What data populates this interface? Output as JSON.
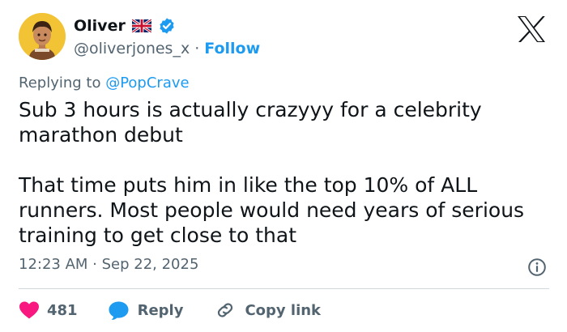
{
  "author": {
    "name": "Oliver",
    "handle": "@oliverjones_x",
    "separator": "·",
    "follow_label": "Follow"
  },
  "reply": {
    "prefix": "Replying to ",
    "mention": "@PopCrave"
  },
  "tweet": {
    "paragraph1": "Sub 3 hours is actually crazyyy for a celebrity marathon debut",
    "paragraph2": "That time puts him in like the top 10% of ALL runners. Most people would need years of serious training to get close to that"
  },
  "timestamp": "12:23 AM · Sep 22, 2025",
  "actions": {
    "like_count": "481",
    "reply_label": "Reply",
    "copy_link_label": "Copy link"
  },
  "icons": {
    "flag": "uk-flag-icon",
    "verified": "verified-badge-icon",
    "logo": "x-logo-icon",
    "info": "info-icon",
    "like": "heart-icon",
    "reply": "speech-bubble-icon",
    "copy_link": "link-icon"
  },
  "colors": {
    "accent": "#1d9bf0",
    "like": "#f91880",
    "text": "#0f1419",
    "secondary": "#536471",
    "avatar_bg": "#f2c335"
  }
}
